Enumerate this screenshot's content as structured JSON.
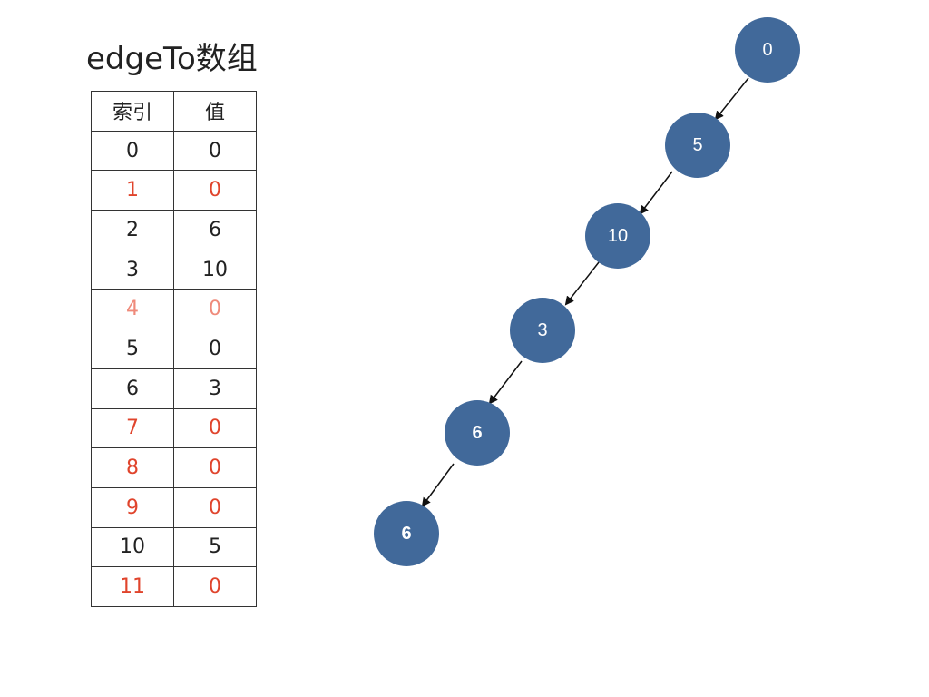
{
  "title": "edgeTo数组",
  "table": {
    "headers": [
      "索引",
      "值"
    ],
    "rows": [
      {
        "index": "0",
        "value": "0",
        "color": "black"
      },
      {
        "index": "1",
        "value": "0",
        "color": "red"
      },
      {
        "index": "2",
        "value": "6",
        "color": "black"
      },
      {
        "index": "3",
        "value": "10",
        "color": "black"
      },
      {
        "index": "4",
        "value": "0",
        "color": "pink"
      },
      {
        "index": "5",
        "value": "0",
        "color": "black"
      },
      {
        "index": "6",
        "value": "3",
        "color": "black"
      },
      {
        "index": "7",
        "value": "0",
        "color": "red"
      },
      {
        "index": "8",
        "value": "0",
        "color": "red"
      },
      {
        "index": "9",
        "value": "0",
        "color": "red"
      },
      {
        "index": "10",
        "value": "5",
        "color": "black"
      },
      {
        "index": "11",
        "value": "0",
        "color": "red"
      }
    ]
  },
  "path_nodes": [
    {
      "label": "0",
      "bold": false
    },
    {
      "label": "5",
      "bold": false
    },
    {
      "label": "10",
      "bold": false
    },
    {
      "label": "3",
      "bold": false
    },
    {
      "label": "6",
      "bold": true
    },
    {
      "label": "6",
      "bold": true
    }
  ],
  "colors": {
    "node_fill": "#41699a",
    "node_text": "#ffffff",
    "highlight_red": "#e0442c",
    "highlight_pink": "#ef8a7a",
    "table_border": "#333333",
    "arrow": "#111111"
  }
}
